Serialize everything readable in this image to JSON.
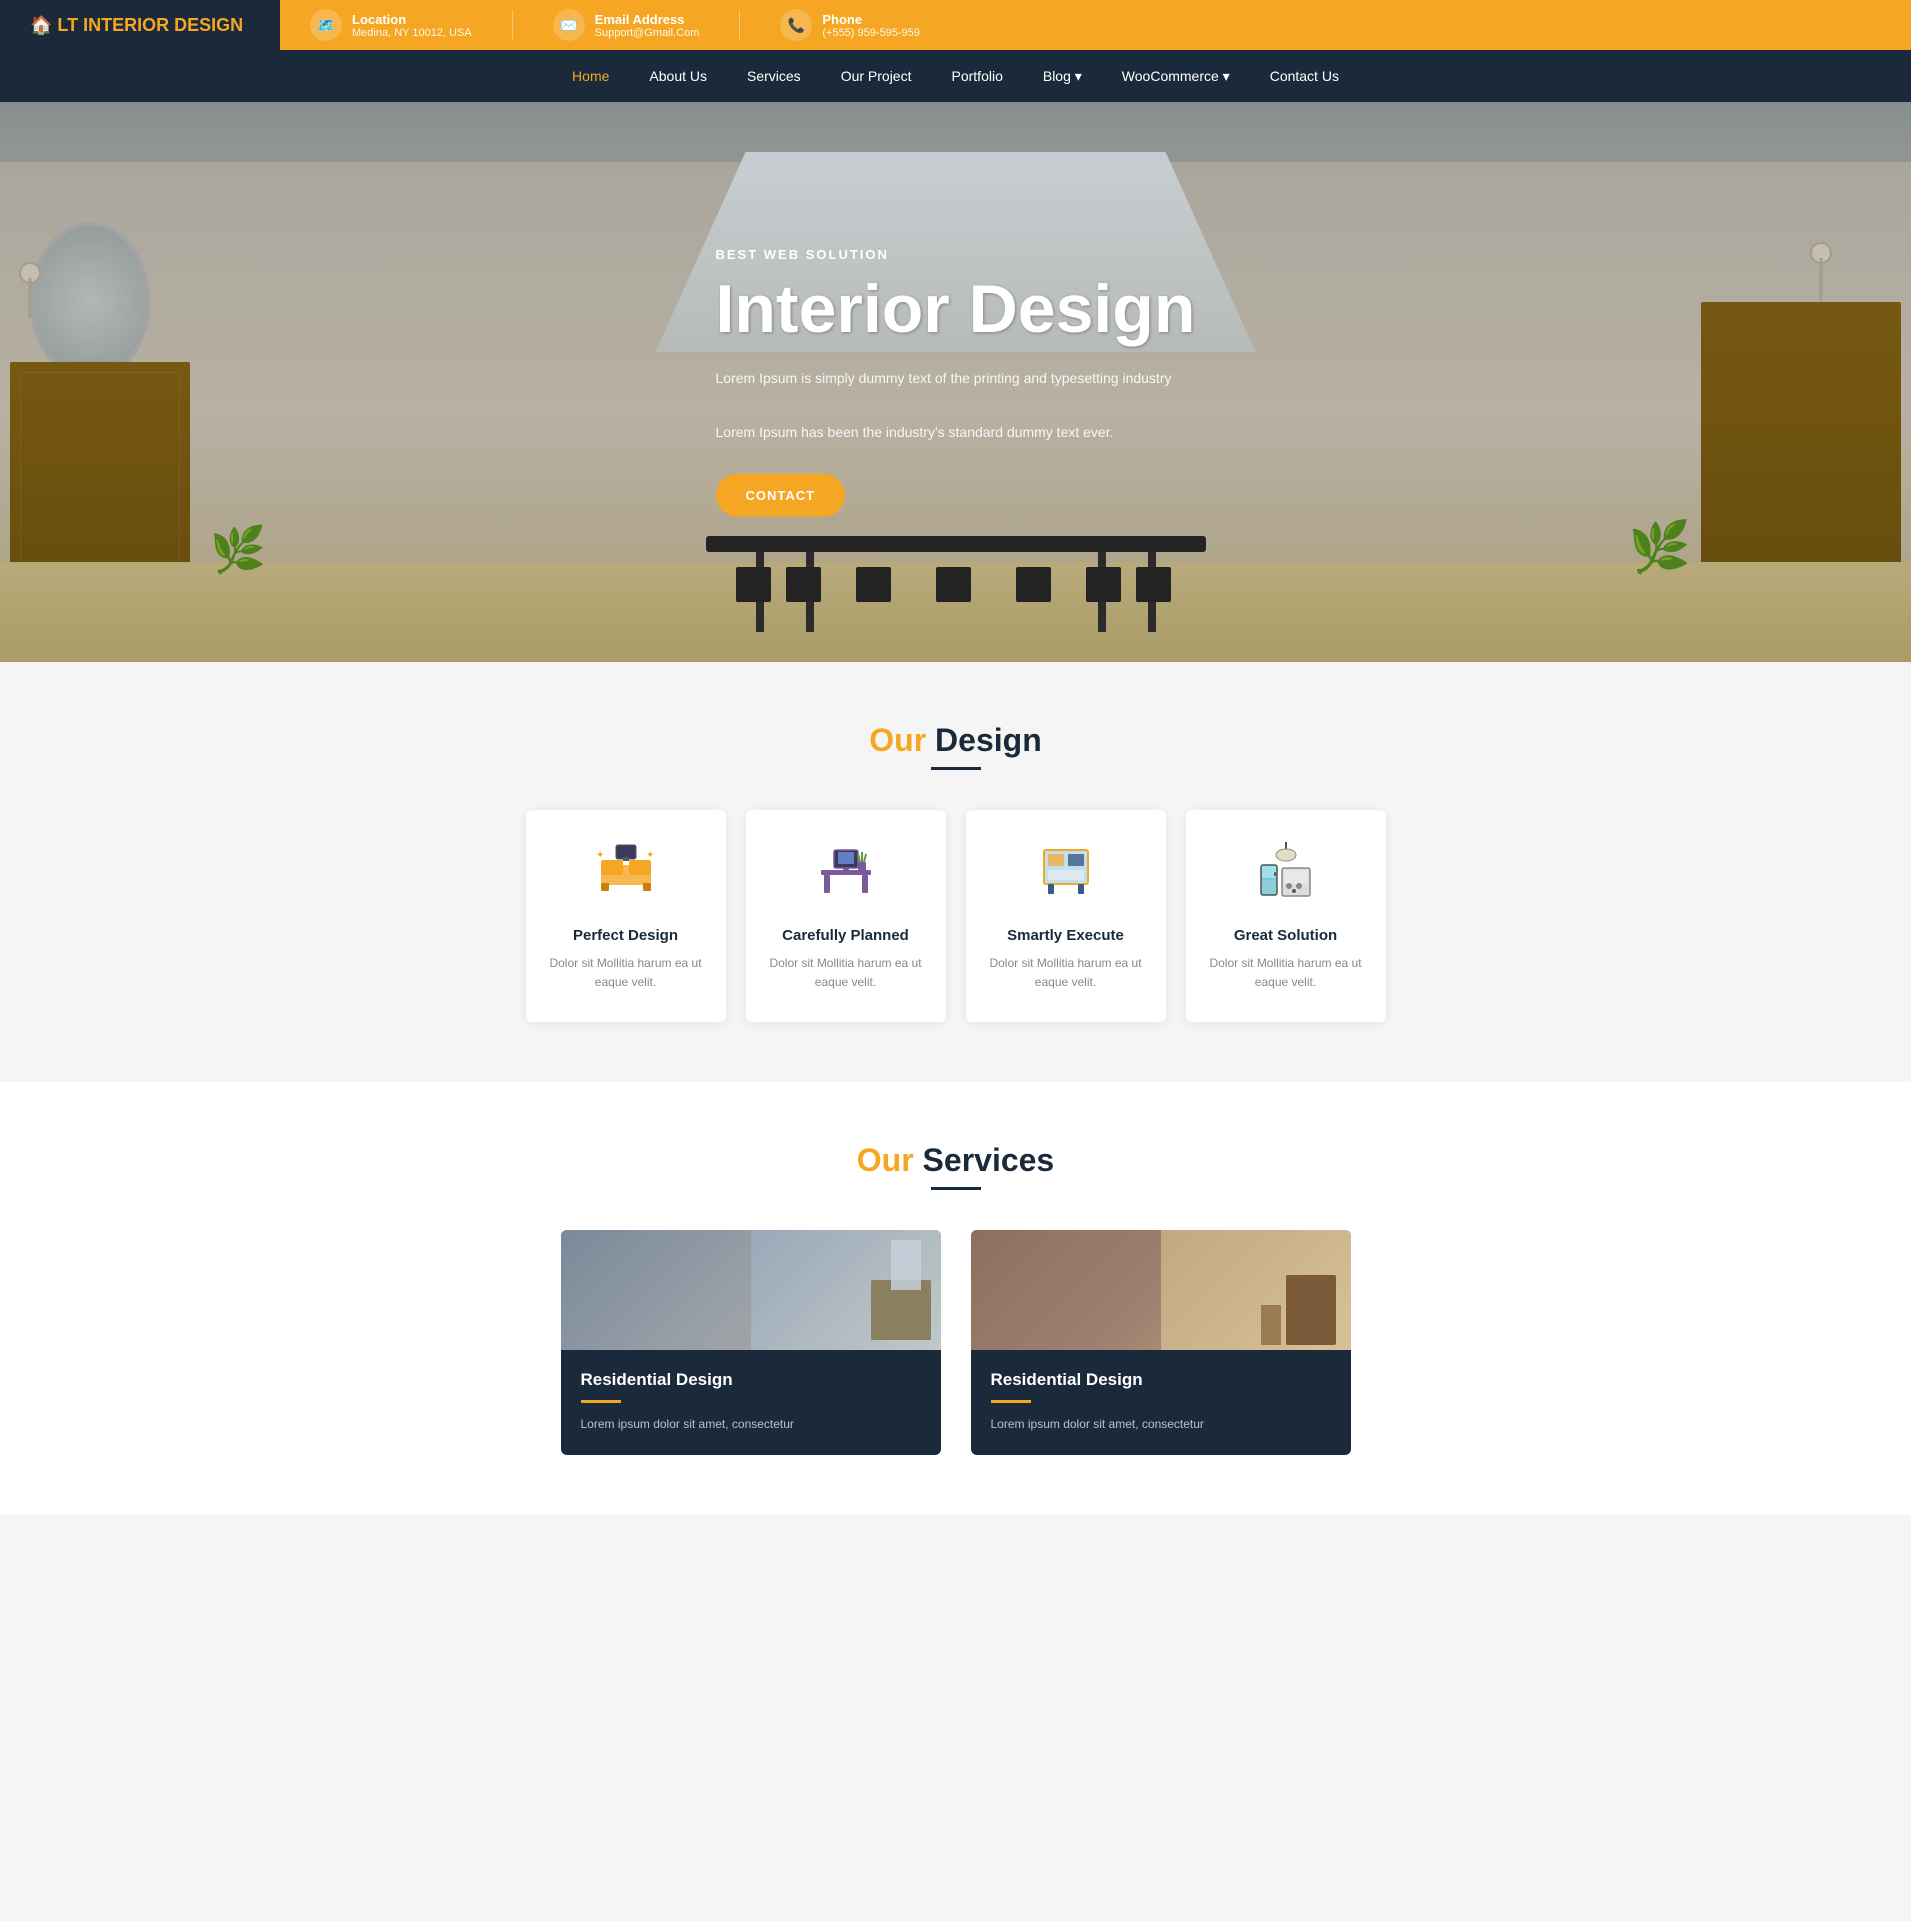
{
  "topbar": {
    "brand": "LT INTERIOR DESIGN",
    "brand_lt": "LT",
    "brand_rest": " INTERIOR DESIGN",
    "location_label": "Location",
    "location_value": "Medina, NY 10012, USA",
    "email_label": "Email Address",
    "email_value": "Support@Gmail.Com",
    "phone_label": "Phone",
    "phone_value": "(+555) 959-595-959"
  },
  "nav": {
    "items": [
      {
        "label": "Home",
        "active": true
      },
      {
        "label": "About Us",
        "active": false
      },
      {
        "label": "Services",
        "active": false
      },
      {
        "label": "Our Project",
        "active": false
      },
      {
        "label": "Portfolio",
        "active": false
      },
      {
        "label": "Blog",
        "active": false,
        "dropdown": true
      },
      {
        "label": "WooCommerce",
        "active": false,
        "dropdown": true
      },
      {
        "label": "Contact Us",
        "active": false
      }
    ]
  },
  "hero": {
    "subtitle": "BEST WEB SOLUTION",
    "title": "Interior Design",
    "desc1": "Lorem Ipsum is simply dummy text of the printing and typesetting industry",
    "desc2": "Lorem Ipsum has been the industry's standard dummy text ever.",
    "cta_label": "CONTACT"
  },
  "design_section": {
    "title_our": "Our",
    "title_main": " Design",
    "cards": [
      {
        "icon": "🛋️",
        "title": "Perfect Design",
        "desc": "Dolor sit Mollitia harum ea ut eaque velit."
      },
      {
        "icon": "🖥️",
        "title": "Carefully Planned",
        "desc": "Dolor sit Mollitia harum ea ut eaque velit."
      },
      {
        "icon": "🏗️",
        "title": "Smartly Execute",
        "desc": "Dolor sit Mollitia harum ea ut eaque velit."
      },
      {
        "icon": "🏠",
        "title": "Great Solution",
        "desc": "Dolor sit Mollitia harum ea ut eaque velit."
      }
    ]
  },
  "services_section": {
    "title_our": "Our",
    "title_main": " Services",
    "cards": [
      {
        "title": "Residential Design",
        "desc": "Lorem ipsum dolor sit amet, consectetur"
      },
      {
        "title": "Residential Design",
        "desc": "Lorem ipsum dolor sit amet, consectetur"
      }
    ]
  }
}
